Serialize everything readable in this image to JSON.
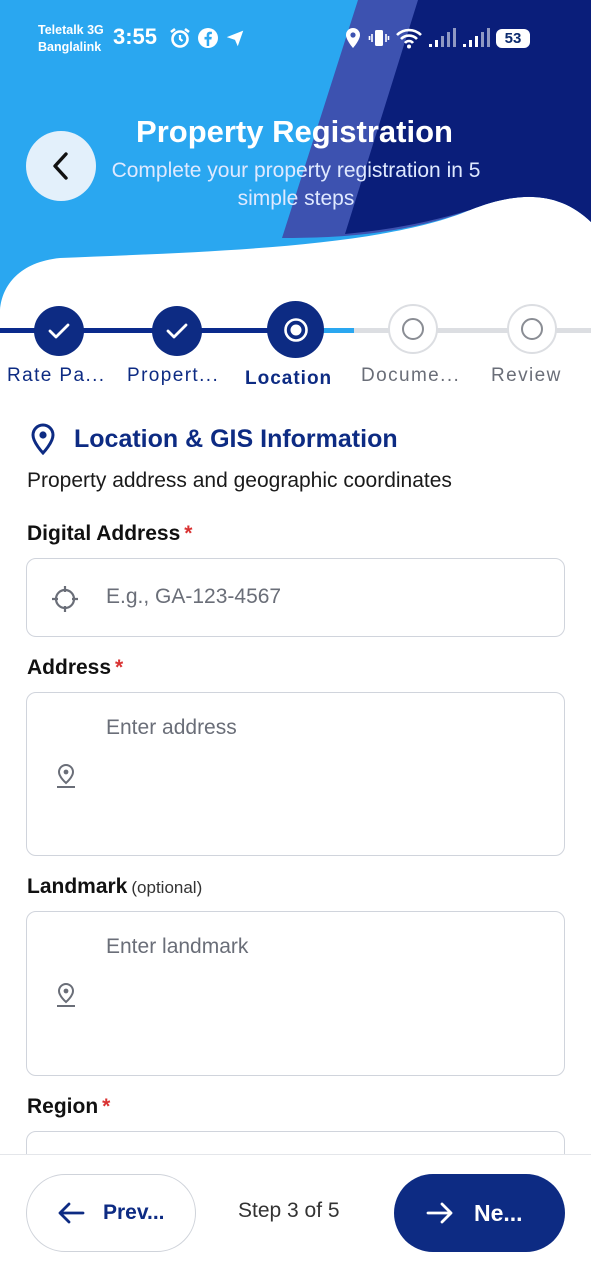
{
  "status_bar": {
    "carrier_1": "Teletalk 3G",
    "carrier_2": "Banglalink",
    "time": "3:55",
    "battery": "53"
  },
  "header": {
    "title": "Property Registration",
    "subtitle": "Complete your property registration in 5 simple steps",
    "colors": {
      "light": "#2aa7f0",
      "dark": "#0a1e7a",
      "mid": "#3d52b0"
    }
  },
  "stepper": {
    "steps": [
      {
        "label": "Rate Pa...",
        "state": "complete"
      },
      {
        "label": "Propert...",
        "state": "complete"
      },
      {
        "label": "Location",
        "state": "current"
      },
      {
        "label": "Docume...",
        "state": "upcoming"
      },
      {
        "label": "Review",
        "state": "upcoming"
      }
    ]
  },
  "section": {
    "title": "Location & GIS Information",
    "description": "Property address and geographic coordinates"
  },
  "form": {
    "digital_address": {
      "label": "Digital Address",
      "required_mark": "*",
      "placeholder": "E.g., GA-123-4567"
    },
    "address": {
      "label": "Address",
      "required_mark": "*",
      "placeholder": "Enter address"
    },
    "landmark": {
      "label": "Landmark",
      "optional": "(optional)",
      "placeholder": "Enter landmark"
    },
    "region": {
      "label": "Region",
      "required_mark": "*"
    }
  },
  "footer": {
    "prev_label": "Prev...",
    "step_indicator": "Step 3 of 5",
    "next_label": "Ne...",
    "accent": "#0d2b83"
  }
}
